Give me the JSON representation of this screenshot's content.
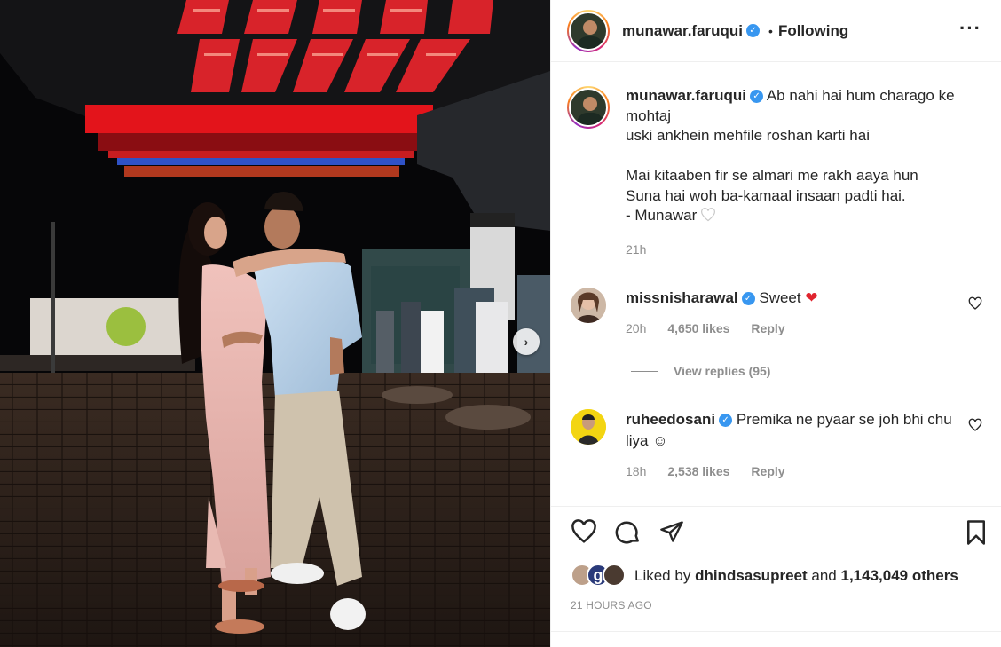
{
  "post": {
    "author": "munawar.faruqui",
    "follow_status": "Following",
    "more_icon": "more-options-icon"
  },
  "caption": {
    "author": "munawar.faruqui",
    "text": "Ab nahi hai hum charago ke mohtaj\nuski ankhein mehfile roshan karti hai\n\nMai kitaaben fir se almari me rakh aaya hun\nSuna hai woh ba-kamaal insaan padti hai.\n- Munawar",
    "time": "21h"
  },
  "comments": [
    {
      "user": "missnisharawal",
      "text": "Sweet",
      "emoji": "red-heart",
      "time": "20h",
      "likes": "4,650 likes",
      "reply": "Reply",
      "view_replies": "View replies (95)"
    },
    {
      "user": "ruheedosani",
      "text": "Premika ne pyaar se joh bhi chu liya ☺",
      "time": "18h",
      "likes": "2,538 likes",
      "reply": "Reply"
    }
  ],
  "actions": {
    "liked_by_prefix": "Liked by",
    "liked_by_user": "dhindsasupreet",
    "liked_by_and": "and",
    "others": "1,143,049 others",
    "time_ago": "21 HOURS AGO"
  },
  "colors": {
    "verified": "#3897f0",
    "secondary_text": "#8e8e8e",
    "heart_red": "#ed4956",
    "divider": "#efefef"
  }
}
